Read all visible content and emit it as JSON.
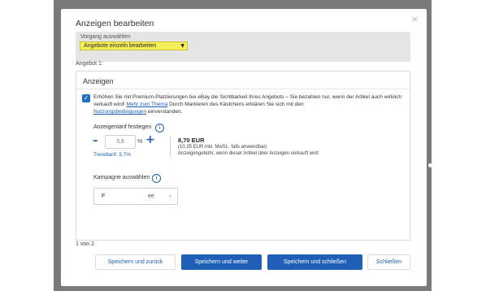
{
  "modal": {
    "title": "Anzeigen bearbeiten",
    "close_glyph": "×"
  },
  "vorgang": {
    "label": "Vorgang auswählen",
    "selected": "Angebote einzeln bearbeiten",
    "arrow_glyph": "▼",
    "highlight_color": "#f5f05a"
  },
  "offer_label": "Angebot 1:",
  "panel": {
    "title": "Anzeigen",
    "checkbox_glyph": "✓",
    "promo_text_1": "Erhöhen Sie mit Premium-Platzierungen bei eBay die Sichtbarkeit Ihres Angebots – Sie bezahlen nur, wenn der Artikel auch wirklich verkauft wird!",
    "promo_link_1": "Mehr zum Thema",
    "promo_text_2": "Durch Markieren des Kästchens erklären Sie sich mit den",
    "promo_link_2": "Nutzungsbedingungen",
    "promo_text_3": "einverstanden.",
    "tarif_label": "Anzeigentarif festlegen",
    "info_glyph": "i",
    "minus_glyph": "–",
    "rate_value": "3,6",
    "percent_sign": "%",
    "plus_glyph": "+",
    "trend": "Trendtarif: 3,7%",
    "fee_amount": "8,70 EUR",
    "fee_incl": "(10,35 EUR inkl. MwSt., falls anwendbar)",
    "fee_note": "Anzeigengebühr, wenn dieser Artikel über Anzeigen verkauft wird",
    "kampagne_label": "Kampagne auswählen",
    "kampagne_value_left": "F",
    "kampagne_value_right": "ee",
    "chevron_glyph": "⌄"
  },
  "pager": "1 von 2",
  "buttons": {
    "save_back": "Speichern und zurück",
    "save_next": "Speichern und weiter",
    "save_close": "Speichern und schließen",
    "close": "Schließen"
  },
  "colors": {
    "primary": "#1f5fb8",
    "link": "#1a5fb4",
    "backdrop": "#7a7a7a"
  }
}
